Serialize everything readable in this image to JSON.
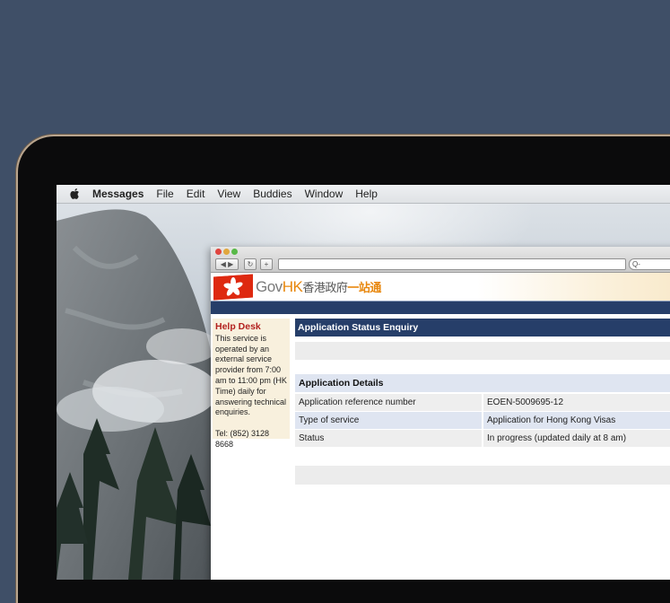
{
  "menubar": {
    "app_name": "Messages",
    "items": [
      "File",
      "Edit",
      "View",
      "Buddies",
      "Window",
      "Help"
    ]
  },
  "browser": {
    "back_forward": "◀ ▶",
    "reload_glyph": "↻",
    "add_glyph": "+",
    "search_glyph": "Q-"
  },
  "banner": {
    "logo_gov": "Gov",
    "logo_hk": "HK",
    "logo_zh": "香港政府",
    "logo_zh_accent": "一站通"
  },
  "helpdesk": {
    "title": "Help Desk",
    "text": "This service is operated by an external service provider from 7:00 am to 11:00 pm (HK Time) daily for answering technical enquiries.",
    "tel": "Tel: (852) 3128 8668"
  },
  "main": {
    "title": "Application Status Enquiry",
    "details_heading": "Application Details",
    "rows": [
      {
        "label": "Application reference number",
        "value": "EOEN-5009695-12"
      },
      {
        "label": "Type of service",
        "value": "Application for Hong Kong Visas"
      },
      {
        "label": "Status",
        "value": "In progress (updated daily at 8 am)"
      }
    ]
  },
  "colors": {
    "background": "#3f4f67",
    "gov_navy": "#263e69",
    "gov_orange": "#e8870d",
    "help_title_red": "#b3211f"
  }
}
